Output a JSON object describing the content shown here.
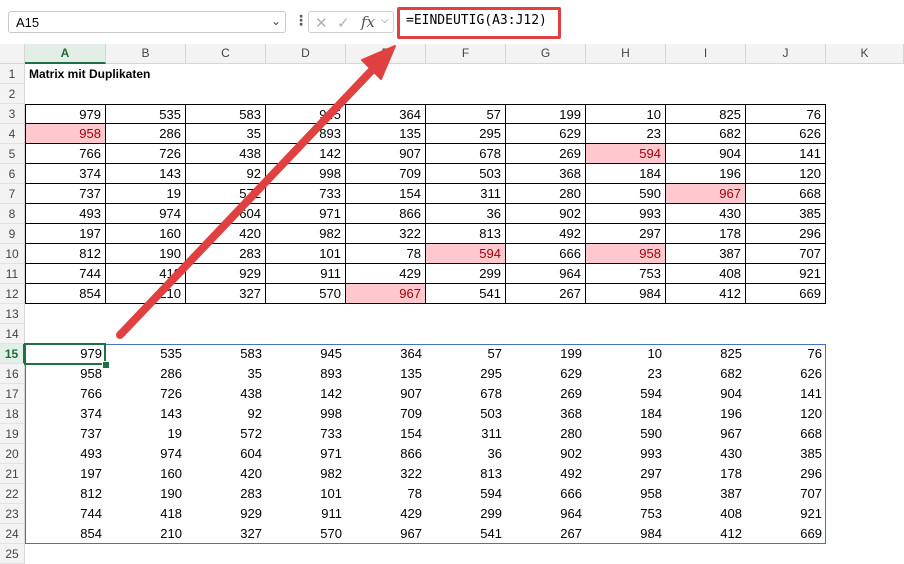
{
  "name_box": {
    "value": "A15"
  },
  "formula_bar": {
    "formula": "=EINDEUTIG(A3:J12)",
    "fx_label": "fx"
  },
  "columns": [
    "A",
    "B",
    "C",
    "D",
    "E",
    "F",
    "G",
    "H",
    "I",
    "J",
    "K"
  ],
  "rows": [
    "1",
    "2",
    "3",
    "4",
    "5",
    "6",
    "7",
    "8",
    "9",
    "10",
    "11",
    "12",
    "13",
    "14",
    "15",
    "16",
    "17",
    "18",
    "19",
    "20",
    "21",
    "22",
    "23",
    "24",
    "25"
  ],
  "title": "Matrix mit Duplikaten",
  "matrix": [
    [
      "979",
      "535",
      "583",
      "945",
      "364",
      "57",
      "199",
      "10",
      "825",
      "76"
    ],
    [
      "958",
      "286",
      "35",
      "893",
      "135",
      "295",
      "629",
      "23",
      "682",
      "626"
    ],
    [
      "766",
      "726",
      "438",
      "142",
      "907",
      "678",
      "269",
      "594",
      "904",
      "141"
    ],
    [
      "374",
      "143",
      "92",
      "998",
      "709",
      "503",
      "368",
      "184",
      "196",
      "120"
    ],
    [
      "737",
      "19",
      "572",
      "733",
      "154",
      "311",
      "280",
      "590",
      "967",
      "668"
    ],
    [
      "493",
      "974",
      "604",
      "971",
      "866",
      "36",
      "902",
      "993",
      "430",
      "385"
    ],
    [
      "197",
      "160",
      "420",
      "982",
      "322",
      "813",
      "492",
      "297",
      "178",
      "296"
    ],
    [
      "812",
      "190",
      "283",
      "101",
      "78",
      "594",
      "666",
      "958",
      "387",
      "707"
    ],
    [
      "744",
      "418",
      "929",
      "911",
      "429",
      "299",
      "964",
      "753",
      "408",
      "921"
    ],
    [
      "854",
      "210",
      "327",
      "570",
      "967",
      "541",
      "267",
      "984",
      "412",
      "669"
    ]
  ],
  "duplicates": [
    [
      1,
      0
    ],
    [
      2,
      7
    ],
    [
      4,
      8
    ],
    [
      7,
      5
    ],
    [
      7,
      7
    ],
    [
      9,
      4
    ]
  ],
  "colors": {
    "duplicate_fill": "#ffc7ce",
    "duplicate_text": "#9c0006",
    "accent": "#1e7145",
    "arrow": "#e04040"
  }
}
